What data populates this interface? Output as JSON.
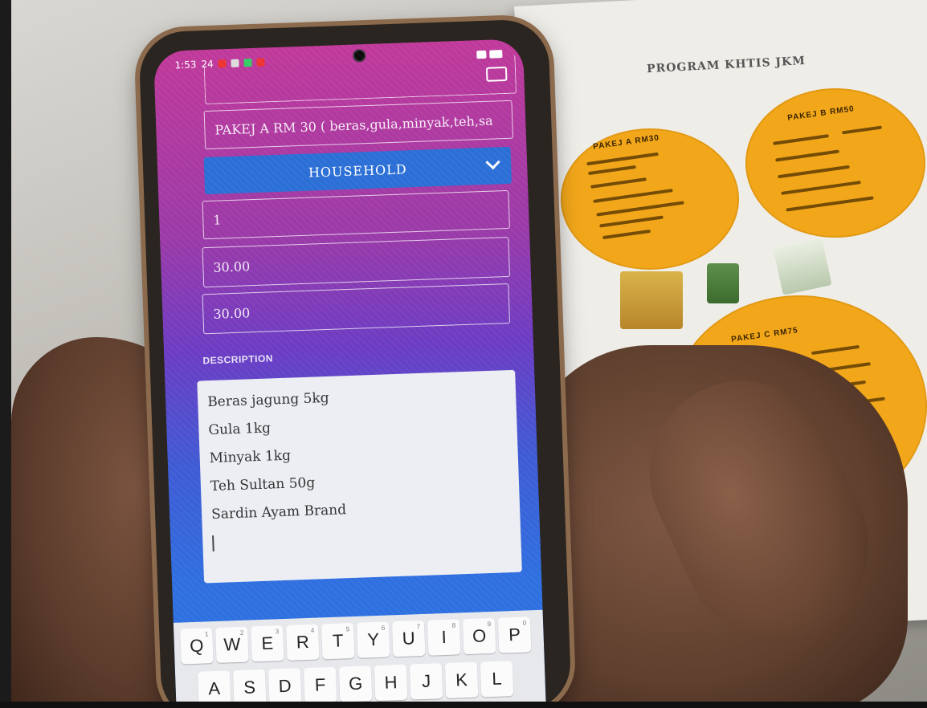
{
  "poster": {
    "title": "PROGRAM KHTIS JKM",
    "packages": [
      {
        "title": "PAKEJ A RM30"
      },
      {
        "title": "PAKEJ B RM50"
      },
      {
        "title": "PAKEJ C RM75"
      }
    ]
  },
  "status_bar": {
    "time": "1:53",
    "indicator": "24"
  },
  "form": {
    "top_partial": "",
    "package_name": "PAKEJ A RM 30 ( beras,gula,minyak,teh,sa",
    "category": "HOUSEHOLD",
    "quantity": "1",
    "price": "30.00",
    "total": "30.00",
    "description_label": "DESCRIPTION",
    "description_lines": [
      "Beras jagung 5kg",
      "Gula 1kg",
      "Minyak 1kg",
      "Teh Sultan 50g",
      "Sardin Ayam Brand"
    ]
  },
  "keyboard": {
    "row1": [
      {
        "key": "Q",
        "hint": "1"
      },
      {
        "key": "W",
        "hint": "2"
      },
      {
        "key": "E",
        "hint": "3"
      },
      {
        "key": "R",
        "hint": "4"
      },
      {
        "key": "T",
        "hint": "5"
      },
      {
        "key": "Y",
        "hint": "6"
      },
      {
        "key": "U",
        "hint": "7"
      },
      {
        "key": "I",
        "hint": "8"
      },
      {
        "key": "O",
        "hint": "9"
      },
      {
        "key": "P",
        "hint": "0"
      }
    ],
    "row2": [
      "A",
      "S",
      "D",
      "F",
      "G",
      "H",
      "J",
      "K",
      "L"
    ]
  },
  "colors": {
    "dropdown": "#2b6fd6",
    "screen_top": "#c0399a",
    "screen_bottom": "#2a74e2",
    "package_circle": "#f2a71a"
  }
}
